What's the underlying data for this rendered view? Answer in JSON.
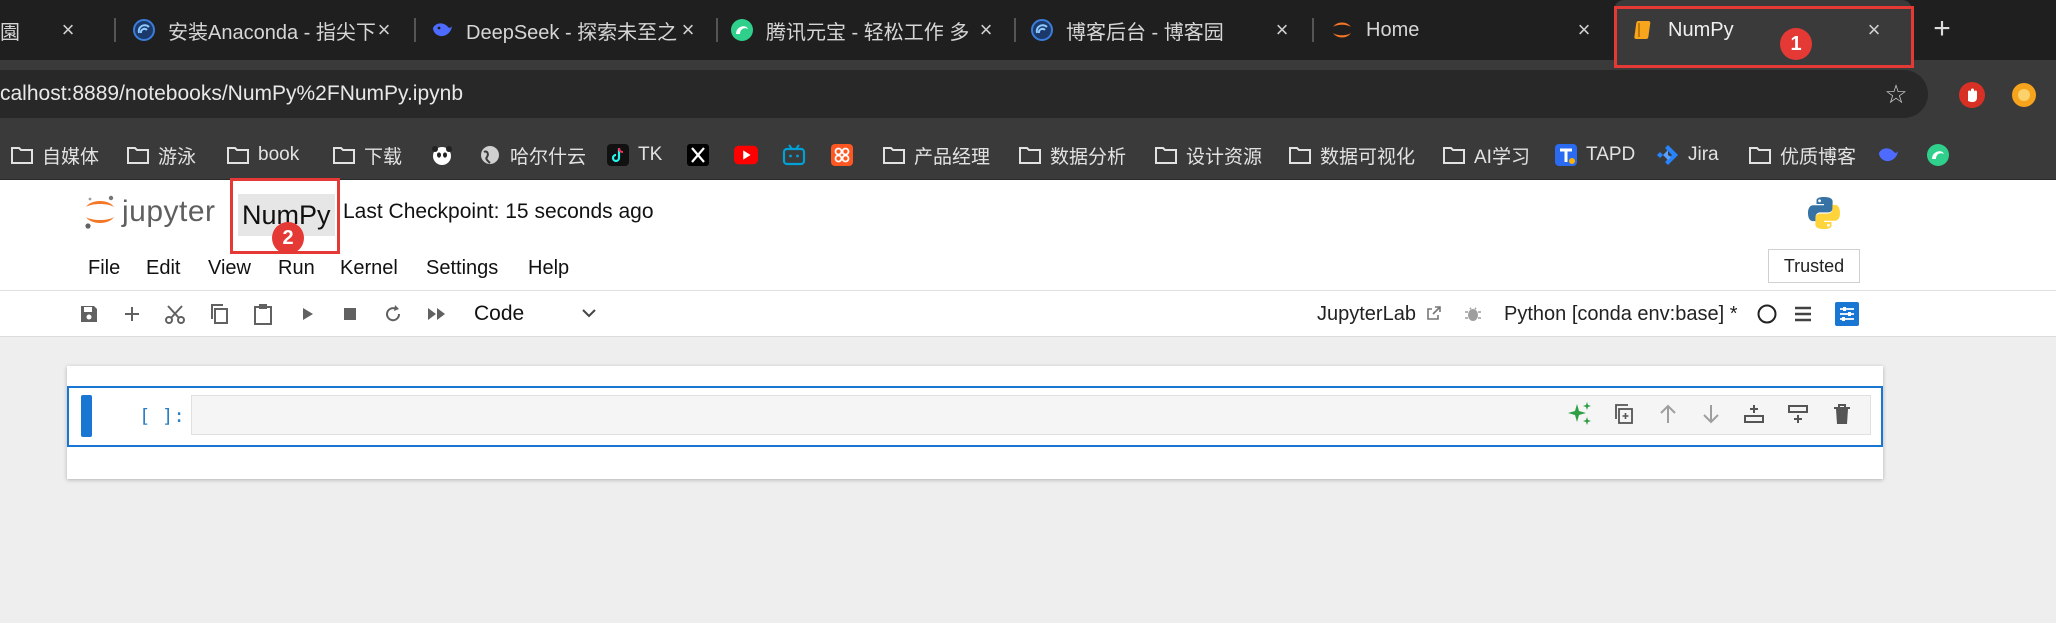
{
  "tabs": [
    {
      "title": "園",
      "icon": "none-icon"
    },
    {
      "title": "安装Anaconda - 指尖下",
      "icon": "blog-icon"
    },
    {
      "title": "DeepSeek - 探索未至之",
      "icon": "deepseek-icon"
    },
    {
      "title": "腾讯元宝 - 轻松工作 多",
      "icon": "yuanbao-icon"
    },
    {
      "title": "博客后台 - 博客园",
      "icon": "blog-icon"
    },
    {
      "title": "Home",
      "icon": "jupyter-icon"
    },
    {
      "title": "NumPy",
      "icon": "notebook-icon"
    }
  ],
  "new_tab_label": "+",
  "close_glyph": "×",
  "address": {
    "url": "calhost:8889/notebooks/NumPy%2FNumPy.ipynb"
  },
  "bookmarks": [
    {
      "label": "自媒体",
      "icon": "folder-icon"
    },
    {
      "label": "游泳",
      "icon": "folder-icon"
    },
    {
      "label": "book",
      "icon": "folder-icon"
    },
    {
      "label": "下载",
      "icon": "folder-icon"
    },
    {
      "label": "",
      "icon": "panda-icon"
    },
    {
      "label": "哈尔什云",
      "icon": "globe-icon"
    },
    {
      "label": "TK",
      "icon": "tiktok-icon"
    },
    {
      "label": "",
      "icon": "x-icon"
    },
    {
      "label": "",
      "icon": "youtube-icon"
    },
    {
      "label": "",
      "icon": "bilibili-icon"
    },
    {
      "label": "",
      "icon": "app-grid-icon"
    },
    {
      "label": "产品经理",
      "icon": "folder-icon"
    },
    {
      "label": "数据分析",
      "icon": "folder-icon"
    },
    {
      "label": "设计资源",
      "icon": "folder-icon"
    },
    {
      "label": "数据可视化",
      "icon": "folder-icon"
    },
    {
      "label": "AI学习",
      "icon": "folder-icon"
    },
    {
      "label": "TAPD",
      "icon": "tapd-icon"
    },
    {
      "label": "Jira",
      "icon": "jira-icon"
    },
    {
      "label": "优质博客",
      "icon": "folder-icon"
    },
    {
      "label": "",
      "icon": "deepseek-icon"
    },
    {
      "label": "",
      "icon": "yuanbao-icon"
    }
  ],
  "jupyter": {
    "logo_text": "jupyter",
    "notebook_name": "NumPy",
    "checkpoint": "Last Checkpoint: 15 seconds ago",
    "menu": [
      "File",
      "Edit",
      "View",
      "Run",
      "Kernel",
      "Settings",
      "Help"
    ],
    "trusted": "Trusted",
    "cell_type": "Code",
    "lab_link": "JupyterLab",
    "kernel": "Python [conda env:base] *",
    "prompt": "[ ]:"
  },
  "annotations": [
    "1",
    "2"
  ],
  "colors": {
    "annotation": "#e53935",
    "cell_border": "#1976d2",
    "tab_strip": "#1f1f1f",
    "active_tab": "#3a3a3a"
  }
}
